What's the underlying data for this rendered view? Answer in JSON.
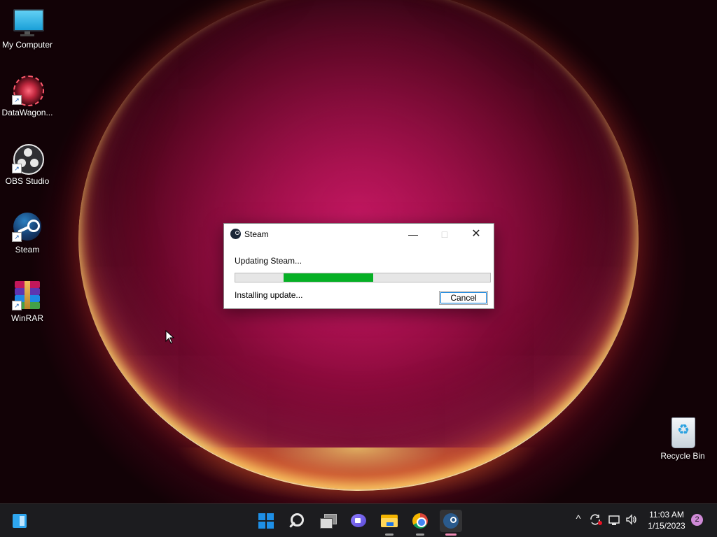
{
  "desktop": {
    "icons": [
      {
        "label": "My Computer",
        "icon": "monitor-icon"
      },
      {
        "label": "DataWagon...",
        "icon": "datawagon-icon"
      },
      {
        "label": "OBS Studio",
        "icon": "obs-studio-icon"
      },
      {
        "label": "Steam",
        "icon": "steam-icon"
      },
      {
        "label": "WinRAR",
        "icon": "winrar-icon"
      },
      {
        "label": "Recycle Bin",
        "icon": "recycle-bin-icon"
      }
    ]
  },
  "dialog": {
    "title": "Steam",
    "status": "Updating Steam...",
    "detail": "Installing update...",
    "progress": {
      "start_fraction": 0.19,
      "end_fraction": 0.54,
      "color": "#06b025"
    },
    "cancel_label": "Cancel",
    "minimize_glyph": "—",
    "maximize_glyph": "□",
    "close_glyph": "✕"
  },
  "taskbar": {
    "apps": [
      {
        "name": "widgets",
        "icon": "widgets-icon"
      },
      {
        "name": "start",
        "icon": "windows-start-icon"
      },
      {
        "name": "search",
        "icon": "search-icon"
      },
      {
        "name": "task-view",
        "icon": "task-view-icon"
      },
      {
        "name": "chat",
        "icon": "teams-chat-icon"
      },
      {
        "name": "file-explorer",
        "icon": "folder-icon",
        "running": true
      },
      {
        "name": "chrome",
        "icon": "chrome-icon",
        "running": true
      },
      {
        "name": "steam",
        "icon": "steam-icon",
        "running": true,
        "active": true
      }
    ],
    "tray": {
      "chevron": "^",
      "icons": [
        "show-hidden-icons-chevron",
        "sync-icon",
        "network-icon",
        "volume-icon"
      ],
      "time": "11:03 AM",
      "date": "1/15/2023",
      "notification_count": "2"
    }
  },
  "colors": {
    "accent": "#0078d7",
    "progress_green": "#06b025",
    "taskbar": "#1c1c1f"
  }
}
